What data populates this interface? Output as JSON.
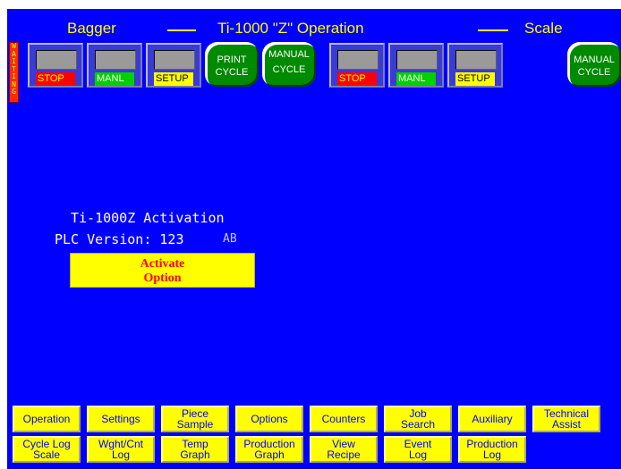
{
  "header": {
    "left": "Bagger",
    "center": "Ti-1000 \"Z\" Operation",
    "right": "Scale"
  },
  "status": {
    "waiting": [
      "W",
      "A",
      "I",
      "T",
      "I",
      "N",
      "G"
    ]
  },
  "bagger_controls": {
    "stop": "STOP",
    "manl": "MANL",
    "setup": "SETUP",
    "print_cycle": [
      "PRINT",
      "CYCLE"
    ],
    "manual_cycle": [
      "MANUAL",
      "CYCLE"
    ]
  },
  "scale_controls": {
    "stop": "STOP",
    "manl": "MANL",
    "setup": "SETUP",
    "manual_cycle": [
      "MANUAL",
      "CYCLE"
    ]
  },
  "activation": {
    "title": "Ti-1000Z Activation",
    "plc_label": "PLC Version: 123",
    "plc_suffix": "AB",
    "button": [
      "Activate",
      "Option"
    ]
  },
  "nav_row1": [
    "Operation",
    "Settings",
    "Piece\nSample",
    "Options",
    "Counters",
    "Job\nSearch",
    "Auxiliary",
    "Technical\nAssist"
  ],
  "nav_row2": [
    "Cycle Log\nScale",
    "Wght/Cnt\nLog",
    "Temp\nGraph",
    "Production\nGraph",
    "View\nRecipe",
    "Event\nLog",
    "Production\nLog"
  ],
  "colors": {
    "background": "#0000ff",
    "title_text": "#ffff00",
    "stop": "#ff0000",
    "manl": "#00d000",
    "setup": "#ffff00",
    "cycle": "#008a00",
    "activate_bg": "#ffff00",
    "activate_text": "#ff0000",
    "waiting": "#ff2a00"
  }
}
